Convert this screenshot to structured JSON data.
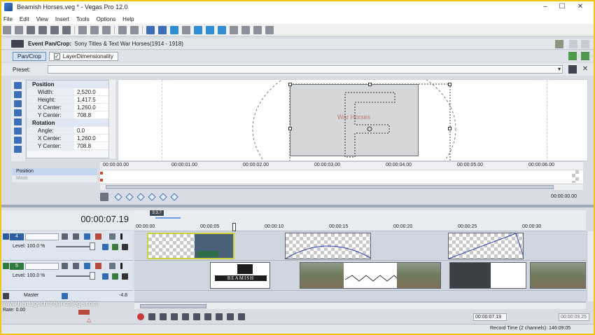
{
  "window": {
    "title": "Beamish Horses.veg * - Vegas Pro 12.0",
    "minimize": "–",
    "maximize": "☐",
    "close": "✕"
  },
  "menu": [
    "File",
    "Edit",
    "View",
    "Insert",
    "Tools",
    "Options",
    "Help"
  ],
  "event_pan_crop": {
    "label": "Event Pan/Crop:",
    "subject": "Sony Titles & Text War Horses(1914 - 1918)",
    "tabs": [
      {
        "label": "Pan/Crop",
        "active": true
      },
      {
        "label": "LayerDimensionality",
        "active": false
      }
    ],
    "preset_label": "Preset:",
    "preset_value": "",
    "properties": [
      {
        "section": "Position"
      },
      {
        "key": "Width:",
        "value": "2,520.0"
      },
      {
        "key": "Height:",
        "value": "1,417.5"
      },
      {
        "key": "X Center:",
        "value": "1,260.0"
      },
      {
        "key": "Y Center:",
        "value": "708.8"
      },
      {
        "section": "Rotation"
      },
      {
        "key": "Angle:",
        "value": "0.0"
      },
      {
        "key": "X Center:",
        "value": "1,260.0"
      },
      {
        "key": "Y Center:",
        "value": "708.8"
      }
    ],
    "preview_text": "War Horses",
    "lanes": [
      "Position",
      "Mask"
    ],
    "ruler": [
      "00:00:00.00",
      "00:00:01.00",
      "00:00:02.00",
      "00:00:03.00",
      "00:00:04.00",
      "00:00:05.00",
      "00:00:06.00"
    ],
    "end_time": "00:00:00.00"
  },
  "timeline": {
    "current_time": "00:00:07.19",
    "cursor_flag": "3:3.7",
    "ruler": [
      "00:00:00",
      "00:00:05",
      "00:00:10",
      "00:00:15",
      "00:00:20",
      "00:00:25",
      "00:00:30"
    ],
    "tracks": [
      {
        "number": "4",
        "level_label": "Level: 100.0 %"
      },
      {
        "number": "5",
        "level_label": "Level: 100.0 %"
      }
    ],
    "clip_title": "BEAMISH",
    "master_label": "Master",
    "master_value": "-4.8",
    "rate_label": "Rate: 0.00",
    "transport_time": "00:00:07.19",
    "transport_time2": "00:00:09.25",
    "record_time": "Record Time (2 channels): 146:09:05"
  },
  "watermark": "www.heritagechristiancollege.com",
  "colors": {
    "accent": "#3b6db8",
    "selection": "#c9d23a",
    "track_green": "#2f7a3f",
    "track_blue": "#2f5fa0"
  }
}
